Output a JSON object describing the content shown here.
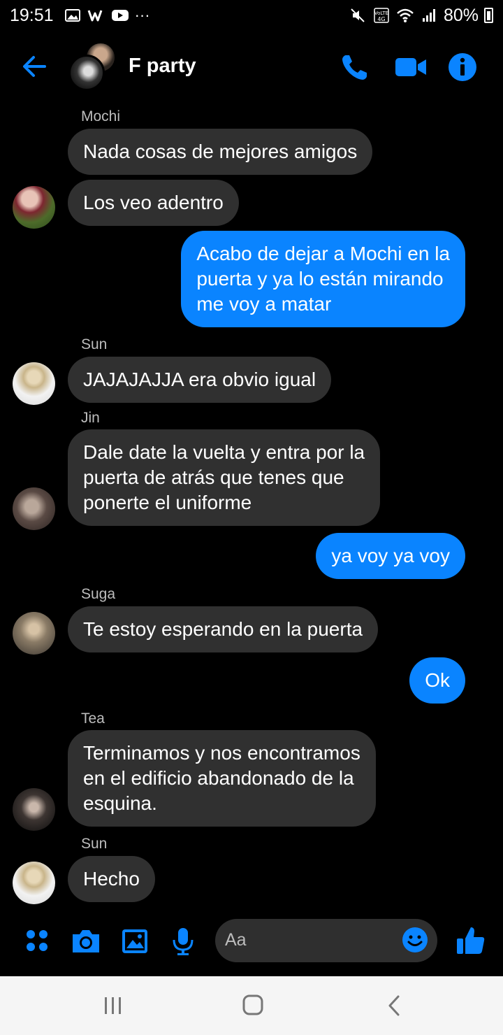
{
  "status_bar": {
    "time": "19:51",
    "battery": "80%",
    "more": "···",
    "icons_left": [
      "image-icon",
      "w-app-icon",
      "youtube-icon"
    ],
    "icons_right": [
      "mute-icon",
      "volte-4g-icon",
      "wifi-icon",
      "signal-icon",
      "battery-icon"
    ],
    "lte_badge": "Vo) 4G"
  },
  "header": {
    "title": "F party",
    "actions": [
      "phone-icon",
      "video-camera-icon",
      "info-icon"
    ]
  },
  "colors": {
    "accent": "#0a84ff",
    "incoming_bubble": "#303030",
    "background": "#000000",
    "sender_name": "#bdbdbd"
  },
  "messages": [
    {
      "sender": "Mochi",
      "text": "Nada cosas de mejores amigos"
    },
    {
      "text": "Los veo adentro"
    },
    {
      "text": "Acabo de dejar a Mochi en la\npuerta y ya lo están mirando\nme voy a matar"
    },
    {
      "sender": "Sun",
      "text": "JAJAJAJJA era obvio igual"
    },
    {
      "sender": "Jin",
      "text": "Dale date la vuelta y entra por la\npuerta de atrás que tenes que\nponerte el uniforme"
    },
    {
      "text": "ya voy ya voy"
    },
    {
      "sender": "Suga",
      "text": "Te estoy esperando en la puerta"
    },
    {
      "text": "Ok"
    },
    {
      "sender": "Tea",
      "text": "Terminamos y nos encontramos\nen el edificio abandonado de la\nesquina."
    },
    {
      "sender": "Sun",
      "text": "Hecho"
    }
  ],
  "composer": {
    "placeholder": "Aa",
    "buttons": [
      "apps-icon",
      "camera-icon",
      "gallery-icon",
      "microphone-icon",
      "emoji-icon",
      "thumbs-up-icon"
    ]
  },
  "navbar": {
    "buttons": [
      "recent-apps-icon",
      "home-icon",
      "back-icon"
    ]
  }
}
